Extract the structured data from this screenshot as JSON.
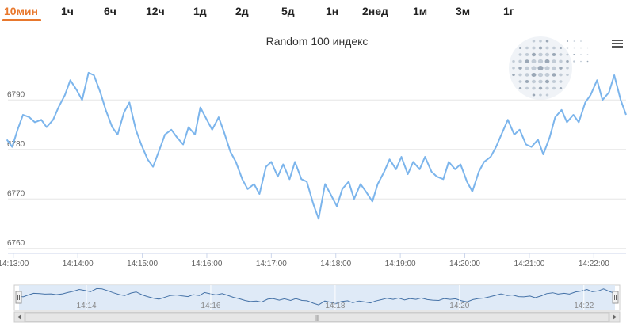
{
  "range_tabs": [
    {
      "label": "10мин",
      "active": true
    },
    {
      "label": "1ч",
      "active": false
    },
    {
      "label": "6ч",
      "active": false
    },
    {
      "label": "12ч",
      "active": false
    },
    {
      "label": "1д",
      "active": false
    },
    {
      "label": "2д",
      "active": false
    },
    {
      "label": "5д",
      "active": false
    },
    {
      "label": "1н",
      "active": false
    },
    {
      "label": "2нед",
      "active": false
    },
    {
      "label": "1м",
      "active": false
    },
    {
      "label": "3м",
      "active": false
    },
    {
      "label": "1г",
      "active": false
    }
  ],
  "menu_icon": "hamburger-icon",
  "logo_icon": "globe-dots-logo",
  "navigator_scroll_label": "|||",
  "chart_data": {
    "type": "line",
    "title": "Random 100 индекс",
    "series": [
      {
        "color": "#7cb5ec",
        "x": [
          "14:12:54",
          "14:12:59",
          "14:13:04",
          "14:13:09",
          "14:13:15",
          "14:13:20",
          "14:13:26",
          "14:13:31",
          "14:13:37",
          "14:13:42",
          "14:13:48",
          "14:13:53",
          "14:13:59",
          "14:14:04",
          "14:14:10",
          "14:14:15",
          "14:14:21",
          "14:14:26",
          "14:14:32",
          "14:14:37",
          "14:14:43",
          "14:14:48",
          "14:14:54",
          "14:14:59",
          "14:15:05",
          "14:15:10",
          "14:15:16",
          "14:15:21",
          "14:15:27",
          "14:15:32",
          "14:15:38",
          "14:15:43",
          "14:15:49",
          "14:15:54",
          "14:16:00",
          "14:16:05",
          "14:16:11",
          "14:16:16",
          "14:16:22",
          "14:16:27",
          "14:16:33",
          "14:16:38",
          "14:16:44",
          "14:16:49",
          "14:16:55",
          "14:17:00",
          "14:17:06",
          "14:17:11",
          "14:17:17",
          "14:17:22",
          "14:17:28",
          "14:17:33",
          "14:17:39",
          "14:17:44",
          "14:17:50",
          "14:17:55",
          "14:18:01",
          "14:18:06",
          "14:18:12",
          "14:18:17",
          "14:18:23",
          "14:18:28",
          "14:18:34",
          "14:18:39",
          "14:18:45",
          "14:18:50",
          "14:18:56",
          "14:19:01",
          "14:19:07",
          "14:19:12",
          "14:19:18",
          "14:19:23",
          "14:19:29",
          "14:19:34",
          "14:19:40",
          "14:19:45",
          "14:19:51",
          "14:19:56",
          "14:20:02",
          "14:20:07",
          "14:20:13",
          "14:20:18",
          "14:20:24",
          "14:20:29",
          "14:20:35",
          "14:20:40",
          "14:20:46",
          "14:20:51",
          "14:20:57",
          "14:21:02",
          "14:21:08",
          "14:21:13",
          "14:21:19",
          "14:21:24",
          "14:21:30",
          "14:21:35",
          "14:21:41",
          "14:21:46",
          "14:21:52",
          "14:21:57",
          "14:22:03",
          "14:22:08",
          "14:22:14",
          "14:22:19",
          "14:22:25",
          "14:22:30"
        ],
        "values": [
          6782.0,
          6780.5,
          6784.0,
          6787.0,
          6786.5,
          6785.5,
          6786.0,
          6784.5,
          6786.0,
          6788.5,
          6791.0,
          6794.0,
          6792.0,
          6790.0,
          6795.5,
          6795.0,
          6791.5,
          6788.0,
          6784.5,
          6783.0,
          6787.5,
          6789.5,
          6784.0,
          6781.0,
          6778.0,
          6776.5,
          6780.0,
          6783.0,
          6784.0,
          6782.5,
          6781.0,
          6784.5,
          6783.0,
          6788.5,
          6786.0,
          6784.0,
          6786.5,
          6783.5,
          6779.5,
          6777.5,
          6774.0,
          6772.0,
          6773.0,
          6771.0,
          6776.5,
          6777.5,
          6774.5,
          6777.0,
          6774.0,
          6777.5,
          6774.0,
          6773.5,
          6769.0,
          6766.0,
          6773.0,
          6771.0,
          6768.5,
          6772.0,
          6773.5,
          6770.0,
          6773.0,
          6771.5,
          6769.5,
          6773.0,
          6775.5,
          6778.0,
          6776.0,
          6778.5,
          6775.0,
          6777.5,
          6776.0,
          6778.5,
          6775.5,
          6774.5,
          6774.0,
          6777.5,
          6776.0,
          6777.0,
          6773.5,
          6771.5,
          6775.5,
          6777.5,
          6778.5,
          6780.5,
          6783.5,
          6786.0,
          6783.0,
          6784.0,
          6781.0,
          6780.5,
          6782.0,
          6779.0,
          6782.5,
          6786.5,
          6788.0,
          6785.5,
          6787.0,
          6785.5,
          6789.5,
          6791.0,
          6794.0,
          6790.0,
          6791.5,
          6795.0,
          6790.0,
          6787.0
        ]
      }
    ],
    "x_ticks": [
      "14:13:00",
      "14:14:00",
      "14:15:00",
      "14:16:00",
      "14:17:00",
      "14:18:00",
      "14:19:00",
      "14:20:00",
      "14:21:00",
      "14:22:00"
    ],
    "y_ticks": [
      6760,
      6770,
      6780,
      6790
    ],
    "ylim": [
      6759,
      6799
    ],
    "x_range": [
      "14:12:55",
      "14:22:30"
    ],
    "grid": true,
    "legend": "none",
    "navigator": {
      "ticks": [
        "14:14",
        "14:16",
        "14:18",
        "14:20",
        "14:22"
      ],
      "fill_color": "#dce8f6",
      "line_color": "#4572a7"
    }
  }
}
